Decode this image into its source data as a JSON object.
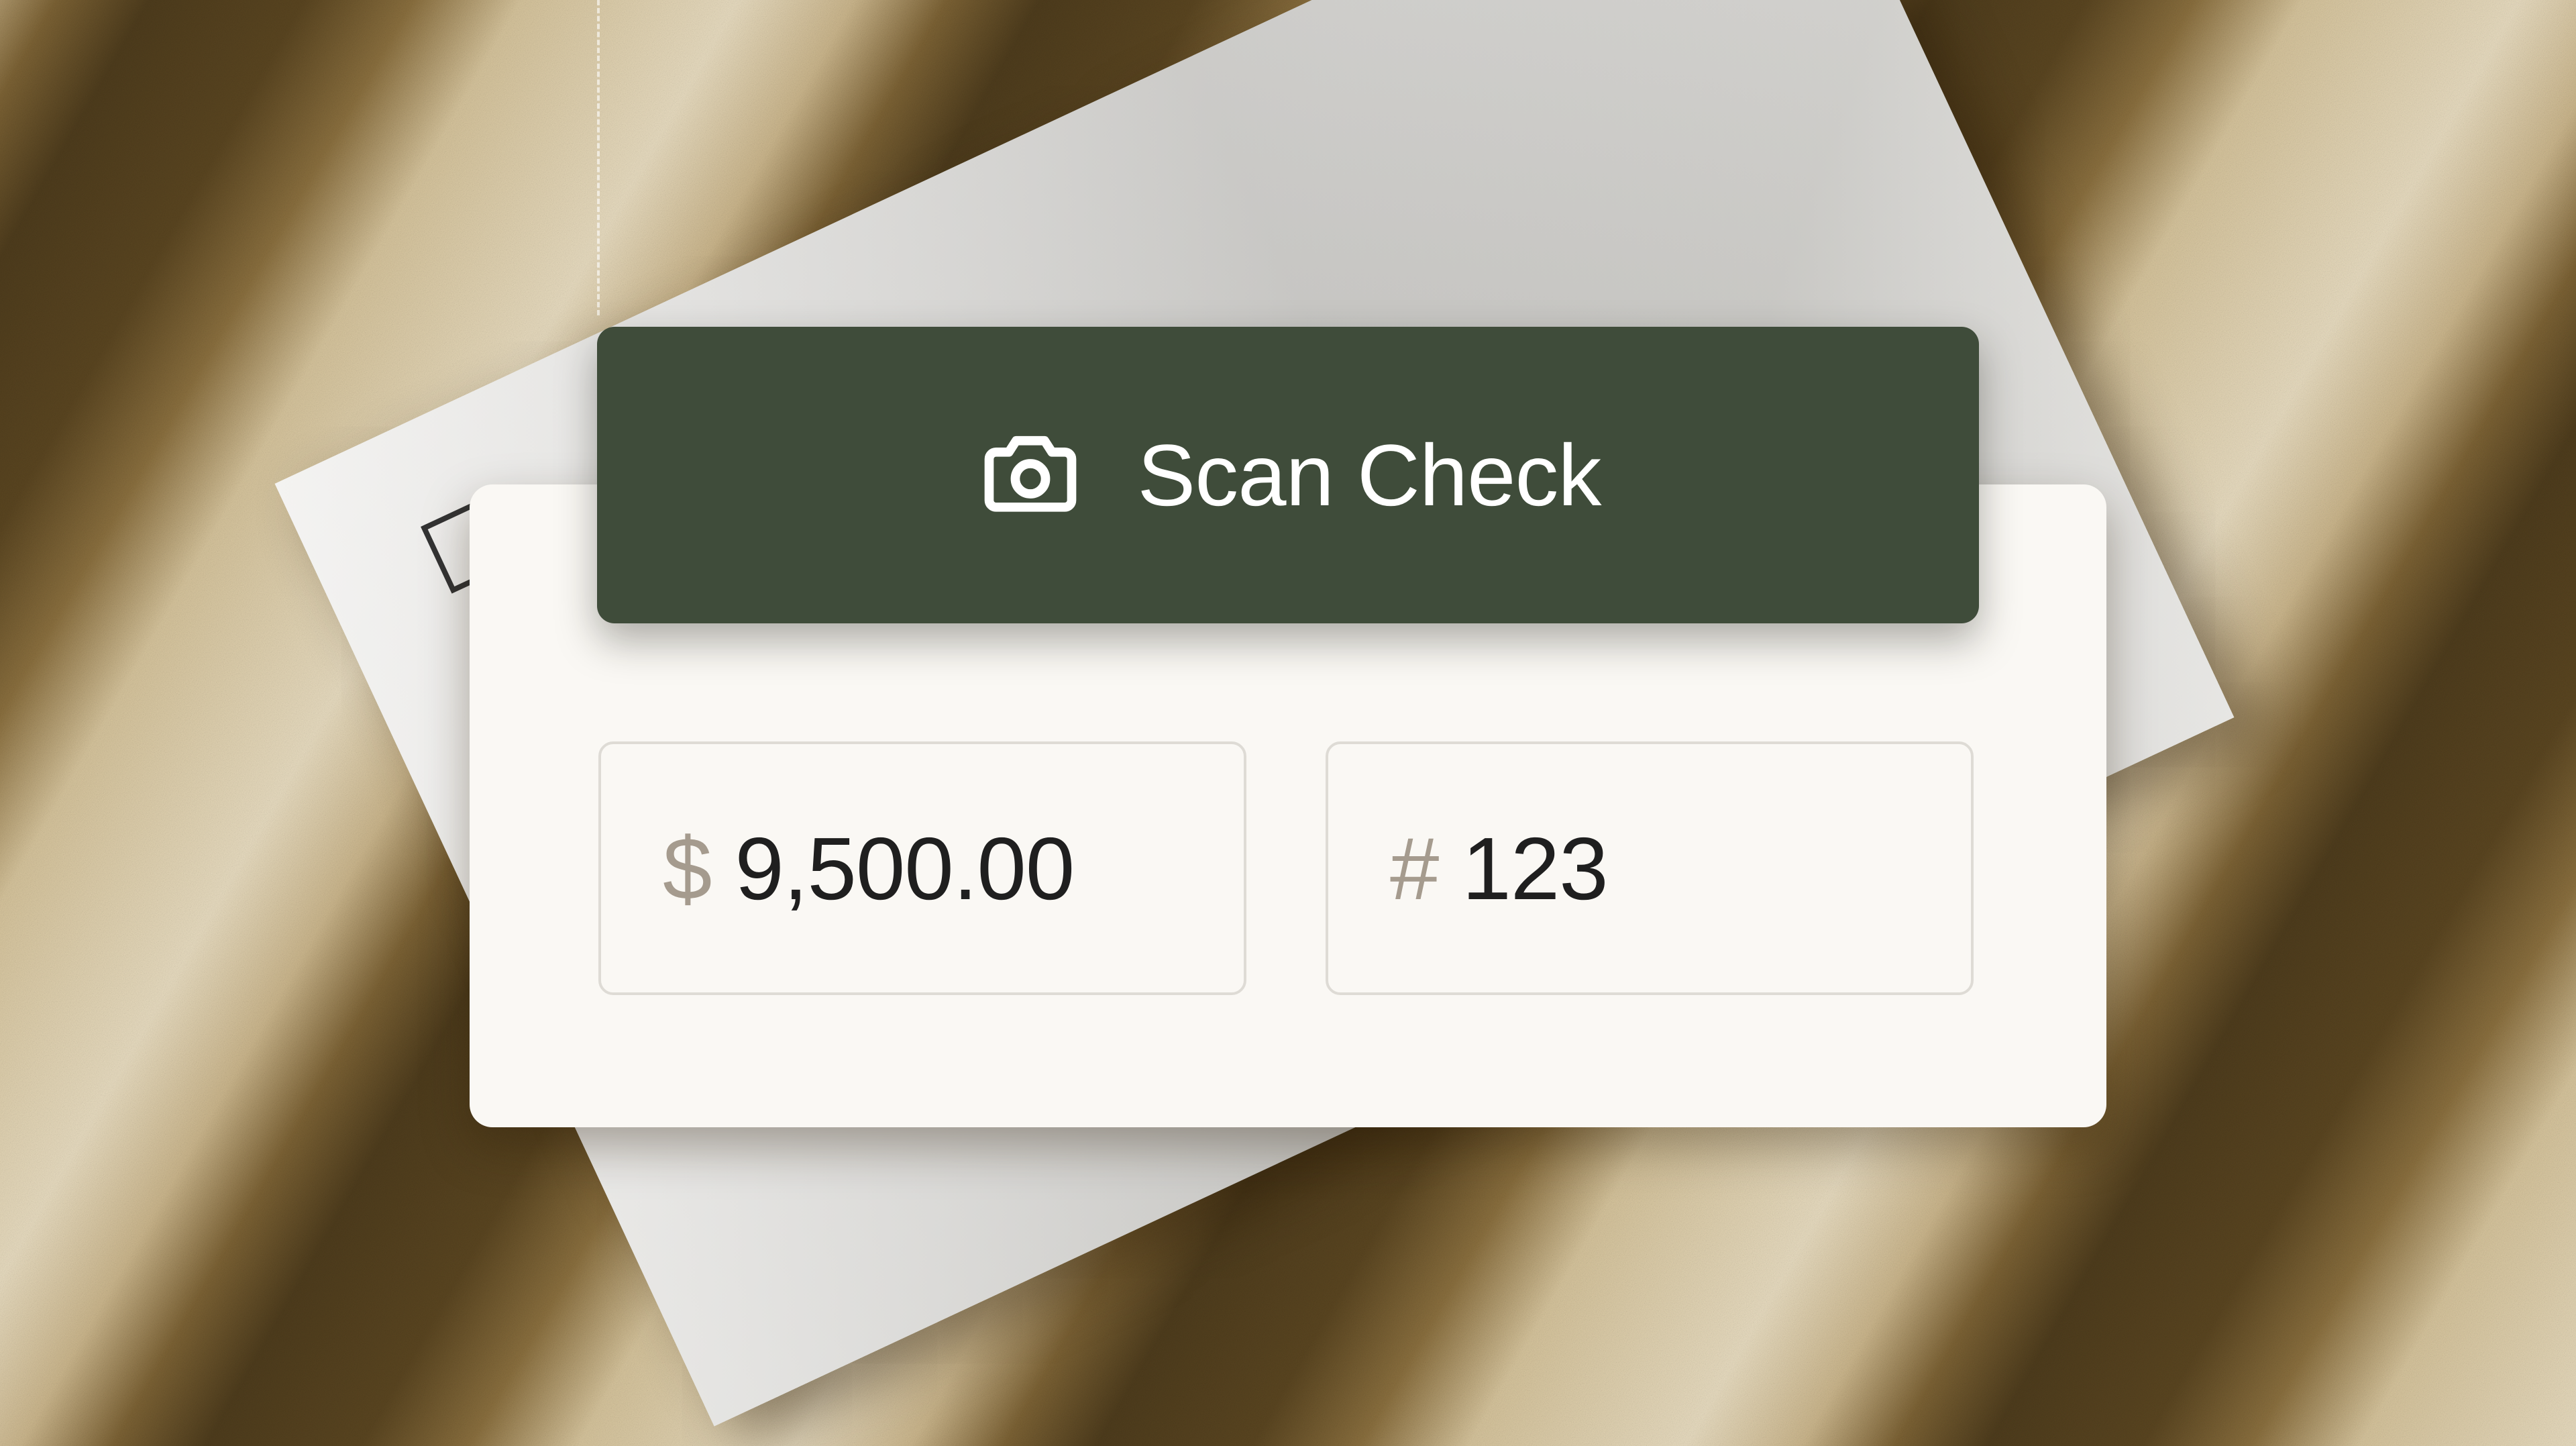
{
  "scan_button": {
    "label": "Scan Check",
    "icon": "camera-icon"
  },
  "amount_field": {
    "prefix": "$",
    "value": "9,500.00"
  },
  "check_number_field": {
    "prefix": "#",
    "value": "123"
  },
  "colors": {
    "button_background": "#3f4c3a",
    "button_text": "#ffffff",
    "card_background": "#faf8f4",
    "field_border": "#dedbd5",
    "prefix_text": "#a59b8e",
    "value_text": "#1f1f1f"
  }
}
